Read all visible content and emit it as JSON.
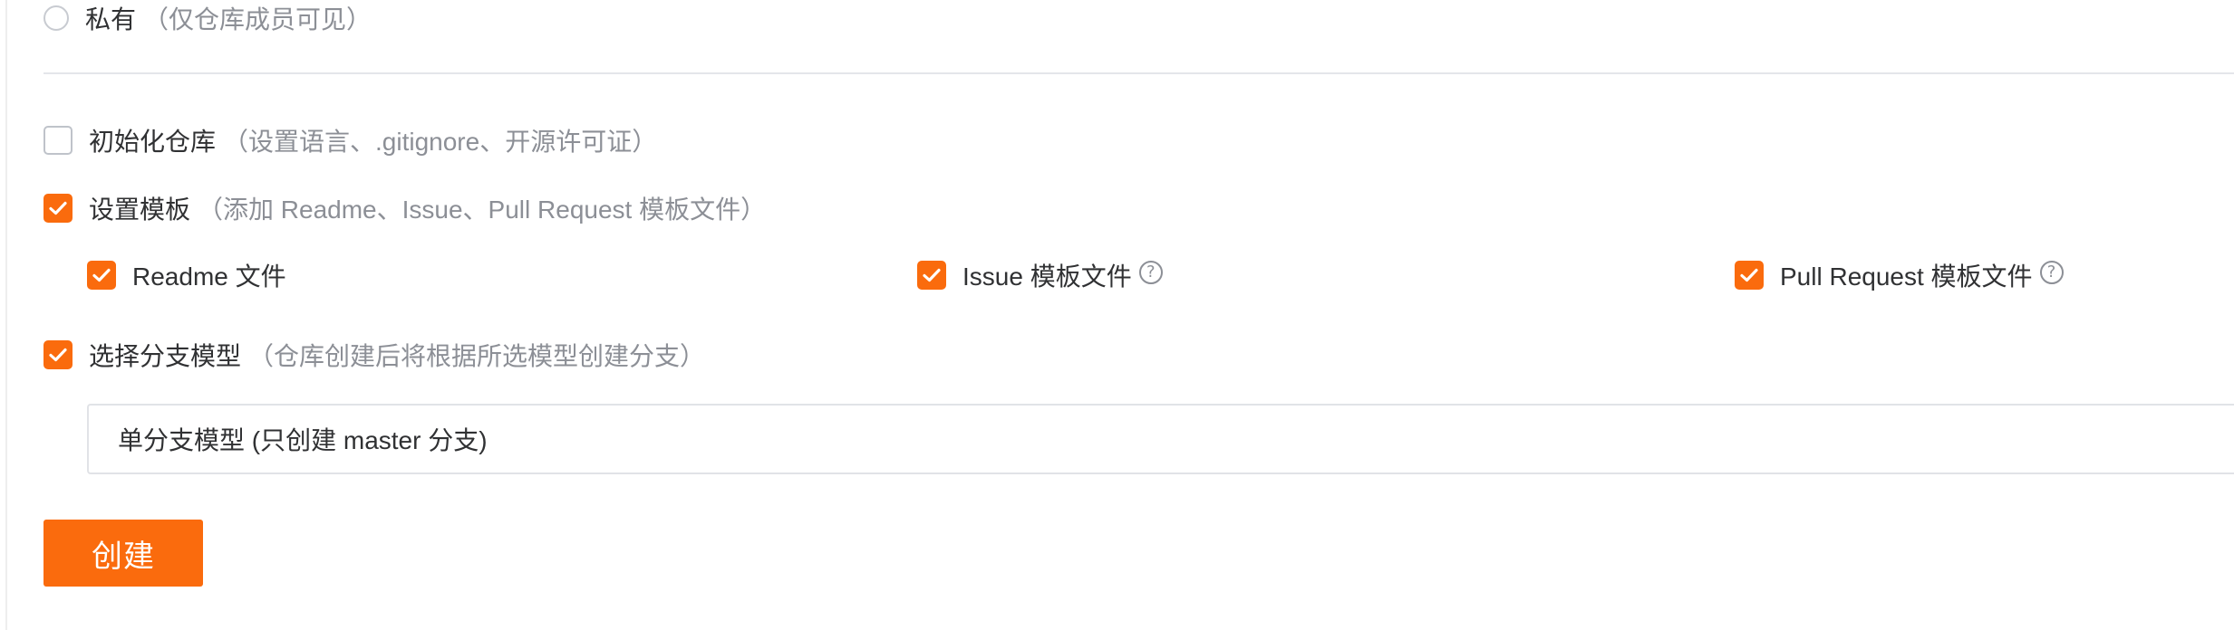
{
  "visibility": {
    "private_label": "私有",
    "private_hint": "（仅仓库成员可见）"
  },
  "init_repo": {
    "label": "初始化仓库",
    "hint": "（设置语言、.gitignore、开源许可证）",
    "checked": false
  },
  "templates": {
    "label": "设置模板",
    "hint": "（添加 Readme、Issue、Pull Request 模板文件）",
    "checked": true,
    "items": [
      {
        "label": "Readme 文件",
        "checked": true,
        "has_help": false
      },
      {
        "label": "Issue 模板文件",
        "checked": true,
        "has_help": true
      },
      {
        "label": "Pull Request 模板文件",
        "checked": true,
        "has_help": true
      }
    ]
  },
  "branch_model": {
    "label": "选择分支模型",
    "hint": "（仓库创建后将根据所选模型创建分支）",
    "checked": true,
    "selected": "单分支模型 (只创建 master 分支)"
  },
  "create_button": "创建",
  "colors": {
    "accent": "#fa6b0d",
    "hint_text": "#8c8f96",
    "main_text": "#303133"
  },
  "icons": {
    "check": "checkmark-icon",
    "help": "question-circle-icon"
  }
}
